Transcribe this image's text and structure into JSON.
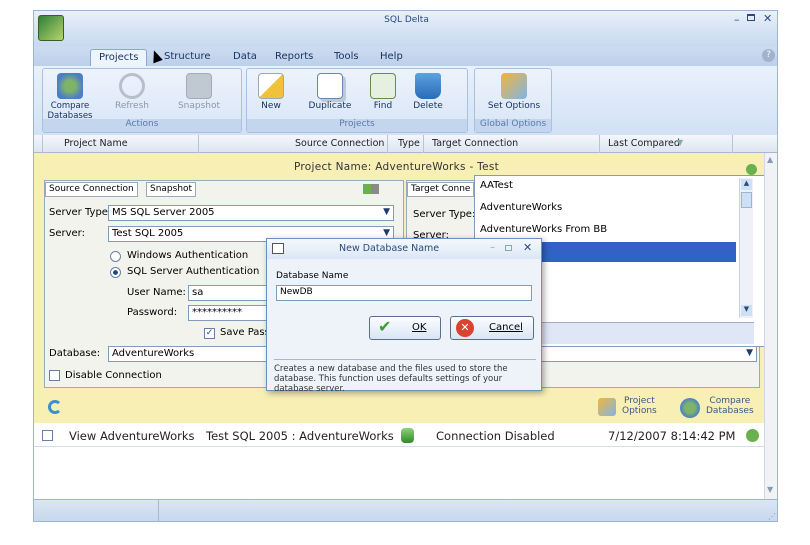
{
  "window": {
    "title": "SQL Delta"
  },
  "menu_tabs": [
    "Projects",
    "Structure",
    "Data",
    "Reports",
    "Tools",
    "Help"
  ],
  "ribbon": {
    "groups": {
      "actions": "Actions",
      "projects": "Projects",
      "global_options": "Global Options"
    },
    "buttons": {
      "compare_databases": "Compare\nDatabases",
      "refresh": "Refresh",
      "snapshot": "Snapshot",
      "new": "New",
      "duplicate": "Duplicate",
      "find": "Find",
      "delete": "Delete",
      "set_options": "Set Options"
    }
  },
  "columns": {
    "project_name": "Project Name",
    "source_connection": "Source Connection",
    "type": "Type",
    "target_connection": "Target Connection",
    "last_compared": "Last Compared"
  },
  "project": {
    "name_band": "Project Name:  AdventureWorks - Test",
    "source_tabs": {
      "connection": "Source Connection",
      "snapshot": "Snapshot"
    },
    "target_tab": "Target Conne",
    "server_type_label": "Server Type:",
    "server_type_value": "MS SQL Server 2005",
    "server_label": "Server:",
    "server_value": "Test SQL 2005",
    "auth_windows": "Windows Authentication",
    "auth_sql": "SQL Server Authentication",
    "username_label": "User Name:",
    "username_value": "sa",
    "password_label": "Password:",
    "password_value": "**********",
    "save_password": "Save Passwo",
    "database_label": "Database:",
    "database_value": "AdventureWorks",
    "disable_connection": "Disable Connection",
    "target_server_type_label": "Server Type:",
    "target_server_label": "Server:",
    "project_options": "Project\nOptions",
    "compare_databases": "Compare\nDatabases"
  },
  "dropdown_items": [
    "AATest",
    "AdventureWorks",
    "AdventureWorks From BB"
  ],
  "dialog": {
    "title": "New Database Name",
    "field_label": "Database Name",
    "field_value": "NewDB",
    "ok": "OK",
    "cancel": "Cancel",
    "description": "Creates a new database and the files used to store the database. This function uses defaults settings of your database server."
  },
  "list_row": {
    "name": "View AdventureWorks",
    "source": "Test SQL 2005 : AdventureWorks",
    "target": "Connection Disabled",
    "last_compared": "7/12/2007 8:14:42 PM"
  },
  "colors": {
    "accent": "#c8d9ef",
    "project_bg": "#f8efb5",
    "selected": "#3163c6"
  }
}
